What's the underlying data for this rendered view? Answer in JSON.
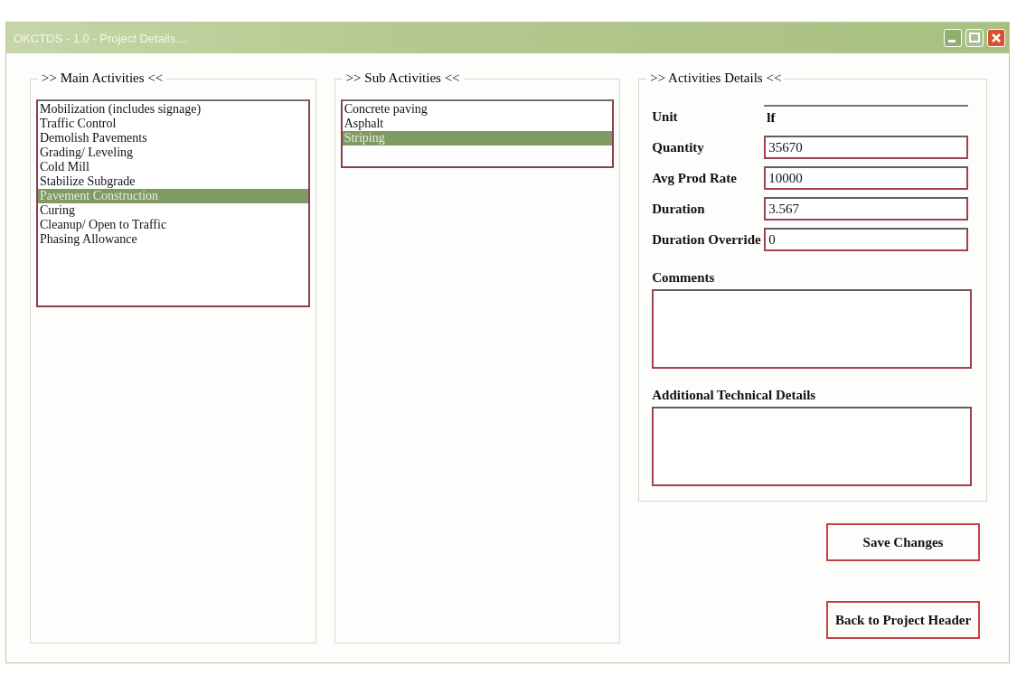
{
  "window": {
    "title": "OKCTDS - 1.0 - Project Details...."
  },
  "main_activities": {
    "title": ">> Main Activities <<",
    "items": [
      {
        "label": "Mobilization (includes signage)",
        "selected": false
      },
      {
        "label": "Traffic Control",
        "selected": false
      },
      {
        "label": "Demolish Pavements",
        "selected": false
      },
      {
        "label": "Grading/ Leveling",
        "selected": false
      },
      {
        "label": "Cold Mill",
        "selected": false
      },
      {
        "label": "Stabilize Subgrade",
        "selected": false
      },
      {
        "label": "Pavement Construction",
        "selected": true
      },
      {
        "label": "Curing",
        "selected": false
      },
      {
        "label": "Cleanup/ Open to Traffic",
        "selected": false
      },
      {
        "label": "Phasing Allowance",
        "selected": false
      }
    ]
  },
  "sub_activities": {
    "title": ">> Sub Activities <<",
    "items": [
      {
        "label": "Concrete paving",
        "selected": false
      },
      {
        "label": "Asphalt",
        "selected": false
      },
      {
        "label": "Striping",
        "selected": true
      }
    ]
  },
  "details": {
    "title": ">> Activities Details <<",
    "fields": [
      {
        "label": "Unit",
        "value": "lf",
        "kind": "readonly"
      },
      {
        "label": "Quantity",
        "value": "35670",
        "kind": "input"
      },
      {
        "label": "Avg Prod Rate",
        "value": "10000",
        "kind": "input"
      },
      {
        "label": "Duration",
        "value": "3.567",
        "kind": "input"
      },
      {
        "label": "Duration Override",
        "value": "0",
        "kind": "input"
      }
    ],
    "comments": {
      "label": "Comments"
    },
    "technical": {
      "label": "Additional Technical Details"
    }
  },
  "buttons": [
    "Save Changes",
    "Back to Project Header"
  ]
}
